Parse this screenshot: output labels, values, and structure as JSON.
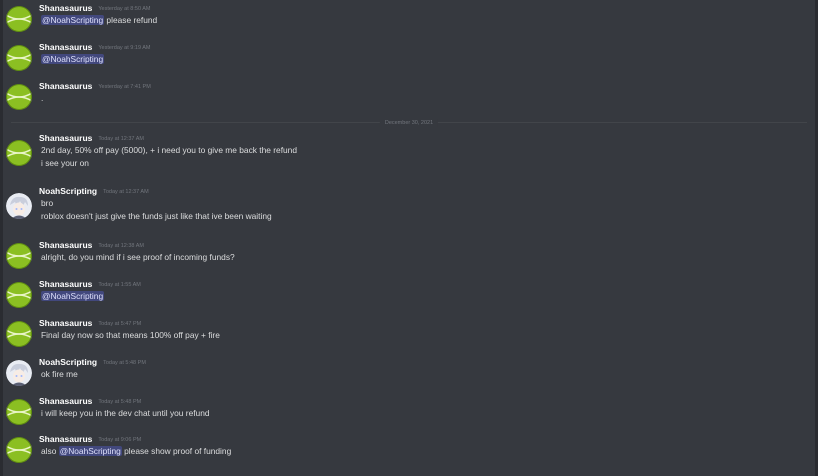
{
  "divider": {
    "label": "December 30, 2021"
  },
  "colors": {
    "background": "#36393f",
    "text": "#dcddde",
    "timestamp": "#72767d",
    "mention_bg": "#4e55a8",
    "avatar_shanasaurus": "#8bbf22"
  },
  "messages": [
    {
      "author": "Shanasaurus",
      "avatar": "yellow-tennis-ball-avatar",
      "timestamp": "Yesterday at 8:50 AM",
      "lines": [
        {
          "mention": "@NoahScripting",
          "after": " please refund"
        }
      ]
    },
    {
      "author": "Shanasaurus",
      "avatar": "yellow-tennis-ball-avatar",
      "timestamp": "Yesterday at 9:19 AM",
      "lines": [
        {
          "mention": "@NoahScripting",
          "after": ""
        }
      ]
    },
    {
      "author": "Shanasaurus",
      "avatar": "yellow-tennis-ball-avatar",
      "timestamp": "Yesterday at 7:41 PM",
      "lines": [
        {
          "text": "."
        }
      ]
    },
    {
      "author": "Shanasaurus",
      "avatar": "yellow-tennis-ball-avatar",
      "timestamp": "Today at 12:37 AM",
      "lines": [
        {
          "text": "2nd day, 50% off pay (5000), + i need you to give me back the refund"
        },
        {
          "text": "i see your on"
        }
      ]
    },
    {
      "author": "NoahScripting",
      "avatar": "anime-character-avatar",
      "timestamp": "Today at 12:37 AM",
      "lines": [
        {
          "text": "bro"
        },
        {
          "text": "roblox doesn't just give the funds just like that ive been waiting"
        }
      ]
    },
    {
      "author": "Shanasaurus",
      "avatar": "yellow-tennis-ball-avatar",
      "timestamp": "Today at 12:38 AM",
      "lines": [
        {
          "text": "alright, do you mind if i see proof of incoming funds?"
        }
      ]
    },
    {
      "author": "Shanasaurus",
      "avatar": "yellow-tennis-ball-avatar",
      "timestamp": "Today at 1:55 AM",
      "lines": [
        {
          "mention": "@NoahScripting",
          "after": ""
        }
      ]
    },
    {
      "author": "Shanasaurus",
      "avatar": "yellow-tennis-ball-avatar",
      "timestamp": "Today at 5:47 PM",
      "lines": [
        {
          "text": "Final day now so that means 100% off pay + fire"
        }
      ]
    },
    {
      "author": "NoahScripting",
      "avatar": "anime-character-avatar",
      "timestamp": "Today at 5:48 PM",
      "lines": [
        {
          "text": "ok fire me"
        }
      ]
    },
    {
      "author": "Shanasaurus",
      "avatar": "yellow-tennis-ball-avatar",
      "timestamp": "Today at 5:48 PM",
      "lines": [
        {
          "text": "i will keep you in the dev chat until you refund"
        }
      ]
    },
    {
      "author": "Shanasaurus",
      "avatar": "yellow-tennis-ball-avatar",
      "timestamp": "Today at 9:06 PM",
      "lines": [
        {
          "before": "also ",
          "mention": "@NoahScripting",
          "after": " please show proof of funding"
        }
      ]
    }
  ]
}
